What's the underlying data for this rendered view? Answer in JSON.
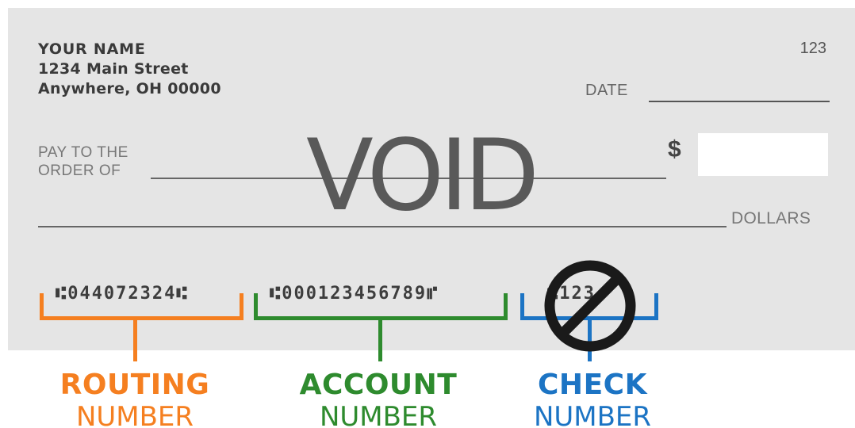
{
  "check": {
    "holder_name": "YOUR NAME",
    "holder_street": "1234 Main Street",
    "holder_city": "Anywhere, OH 00000",
    "check_number": "123",
    "date_label": "DATE",
    "pay_to_line1": "PAY TO THE",
    "pay_to_line2": "ORDER OF",
    "dollar_sign": "$",
    "dollars_label": "DOLLARS",
    "void_text": "VOID"
  },
  "micr": {
    "routing": "⑆044072324⑆",
    "account": "⑆000123456789⑈",
    "check": "⑆123"
  },
  "labels": {
    "routing_top": "ROUTING",
    "routing_bottom": "NUMBER",
    "account_top": "ACCOUNT",
    "account_bottom": "NUMBER",
    "check_top": "CHECK",
    "check_bottom": "NUMBER"
  },
  "colors": {
    "routing": "#f57f20",
    "account": "#2e8b2e",
    "check": "#1c74c4",
    "check_paper": "#e5e5e5"
  },
  "icons": {
    "prohibition": "no-sign-icon"
  }
}
